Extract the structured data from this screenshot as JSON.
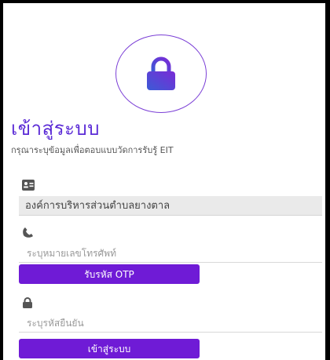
{
  "header": {
    "title": "เข้าสู่ระบบ",
    "subtitle": "กรุณาระบุข้อมูลเพื่อตอบแบบวัดการรับรู้ EIT"
  },
  "icons": {
    "lock_main": "lock-icon",
    "organization": "id-card-icon",
    "phone": "phone-icon",
    "password": "lock-icon"
  },
  "form": {
    "organization_value": "องค์การบริหารส่วนตำบลยางตาล",
    "phone_placeholder": "ระบุหมายเลขโทรศัพท์",
    "otp_button": "รับรหัส OTP",
    "confirm_placeholder": "ระบุรหัสยืนยัน",
    "login_button": "เข้าสู่ระบบ"
  },
  "colors": {
    "accent": "#6f1bd6",
    "lock_gradient_start": "#3b5bd6",
    "lock_gradient_end": "#7a2bd6"
  }
}
